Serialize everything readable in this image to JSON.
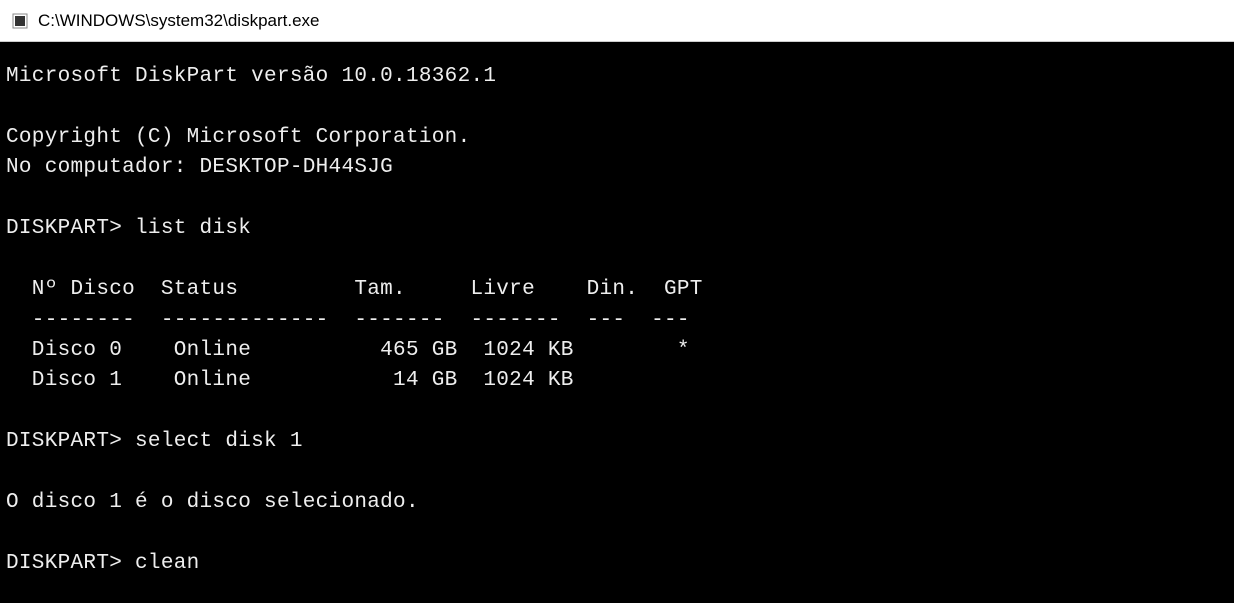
{
  "titlebar": {
    "path": "C:\\WINDOWS\\system32\\diskpart.exe"
  },
  "terminal": {
    "version_line": "Microsoft DiskPart versão 10.0.18362.1",
    "copyright_line": "Copyright (C) Microsoft Corporation.",
    "computer_line": "No computador: DESKTOP-DH44SJG",
    "prompt": "DISKPART>",
    "cmd1": "list disk",
    "table_header": "  Nº Disco  Status         Tam.     Livre    Din.  GPT",
    "table_sep": "  --------  -------------  -------  -------  ---  ---",
    "table_row0": "  Disco 0    Online          465 GB  1024 KB        *",
    "table_row1": "  Disco 1    Online           14 GB  1024 KB",
    "cmd2": "select disk 1",
    "select_response": "O disco 1 é o disco selecionado.",
    "cmd3": "clean"
  }
}
